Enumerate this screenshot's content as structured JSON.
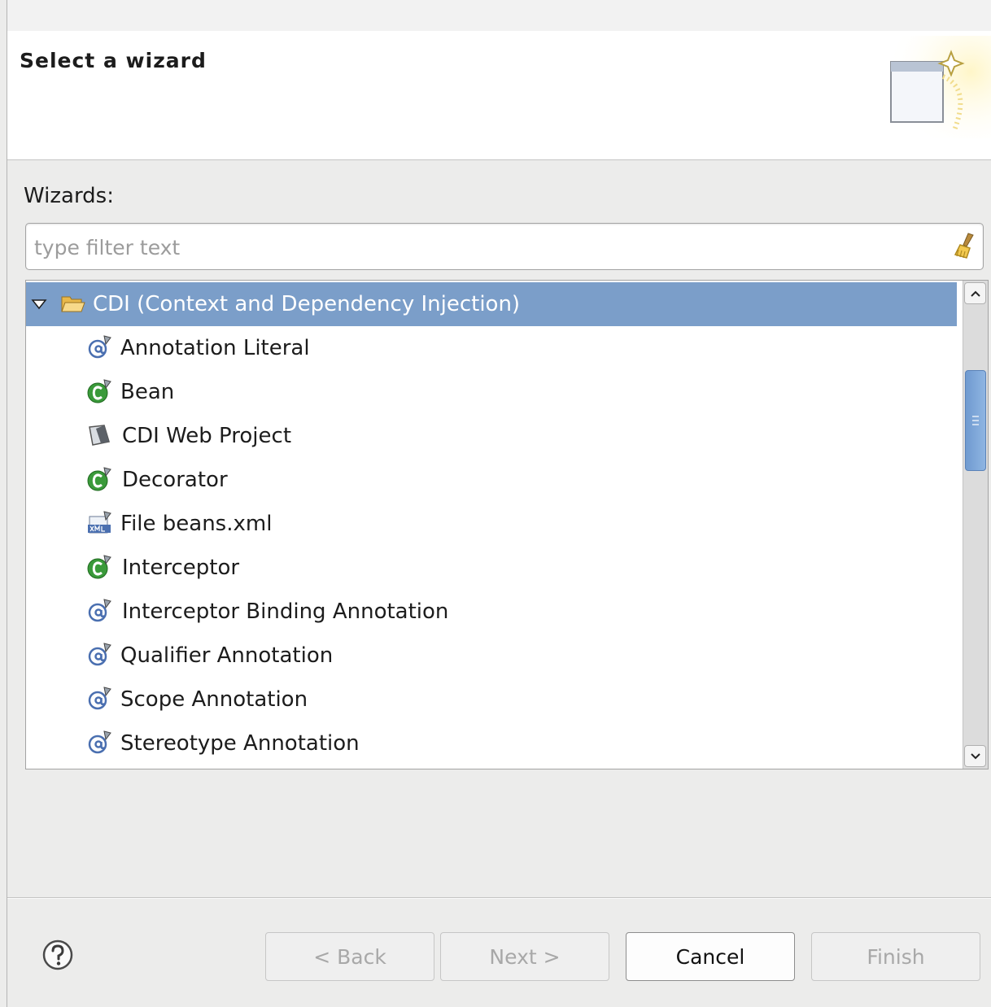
{
  "header": {
    "title": "Select a wizard"
  },
  "filter": {
    "label": "Wizards:",
    "placeholder": "type filter text",
    "value": ""
  },
  "tree": {
    "category": {
      "label": "CDI (Context and Dependency Injection)",
      "expanded": true,
      "selected": true
    },
    "items": [
      {
        "label": "Annotation Literal",
        "icon": "annotation-icon"
      },
      {
        "label": "Bean",
        "icon": "class-icon"
      },
      {
        "label": "CDI Web Project",
        "icon": "project-icon"
      },
      {
        "label": "Decorator",
        "icon": "class-icon"
      },
      {
        "label": "File beans.xml",
        "icon": "xml-file-icon"
      },
      {
        "label": "Interceptor",
        "icon": "class-icon"
      },
      {
        "label": "Interceptor Binding Annotation",
        "icon": "annotation-icon"
      },
      {
        "label": "Qualifier Annotation",
        "icon": "annotation-icon"
      },
      {
        "label": "Scope Annotation",
        "icon": "annotation-icon"
      },
      {
        "label": "Stereotype Annotation",
        "icon": "annotation-icon"
      }
    ]
  },
  "buttons": {
    "back": {
      "label": "< Back",
      "enabled": false
    },
    "next": {
      "label": "Next >",
      "enabled": false
    },
    "cancel": {
      "label": "Cancel",
      "enabled": true
    },
    "finish": {
      "label": "Finish",
      "enabled": false
    }
  },
  "colors": {
    "selection": "#7b9ec9",
    "scroll_thumb": "#7ea7d9",
    "class_icon": "#3a9a3a",
    "annotation_icon": "#4a6fb0"
  }
}
